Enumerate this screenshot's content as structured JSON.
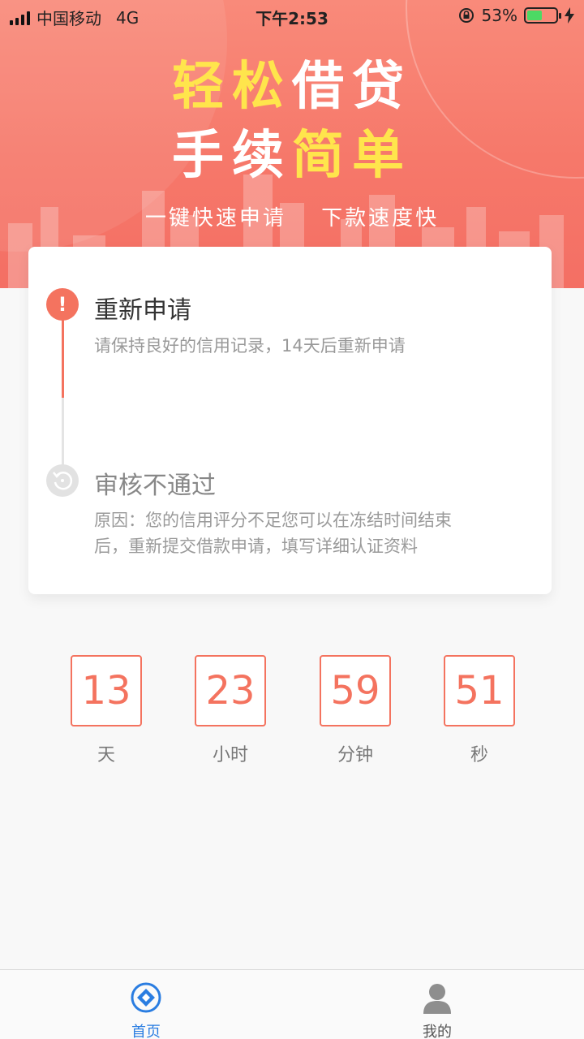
{
  "status_bar": {
    "carrier": "中国移动",
    "network": "4G",
    "time": "下午2:53",
    "battery": "53%",
    "battery_level": 0.53
  },
  "banner": {
    "line1_part1": "轻松",
    "line1_part2": "借贷",
    "line2_part1": "手续",
    "line2_part2": "简单",
    "slogan_left": "一键快速申请",
    "slogan_right": "下款速度快"
  },
  "steps": [
    {
      "title": "重新申请",
      "desc": "请保持良好的信用记录，14天后重新申请",
      "icon": "exclamation-icon"
    },
    {
      "title": "审核不通过",
      "desc": "原因：您的信用评分不足您可以在冻结时间结束后，重新提交借款申请，填写详细认证资料",
      "icon": "refresh-icon"
    }
  ],
  "countdown": [
    {
      "value": "13",
      "unit": "天"
    },
    {
      "value": "23",
      "unit": "小时"
    },
    {
      "value": "59",
      "unit": "分钟"
    },
    {
      "value": "51",
      "unit": "秒"
    }
  ],
  "tabbar": {
    "home": "首页",
    "me": "我的"
  },
  "colors": {
    "accent": "#f4735f",
    "tab_active": "#2a7de1"
  }
}
